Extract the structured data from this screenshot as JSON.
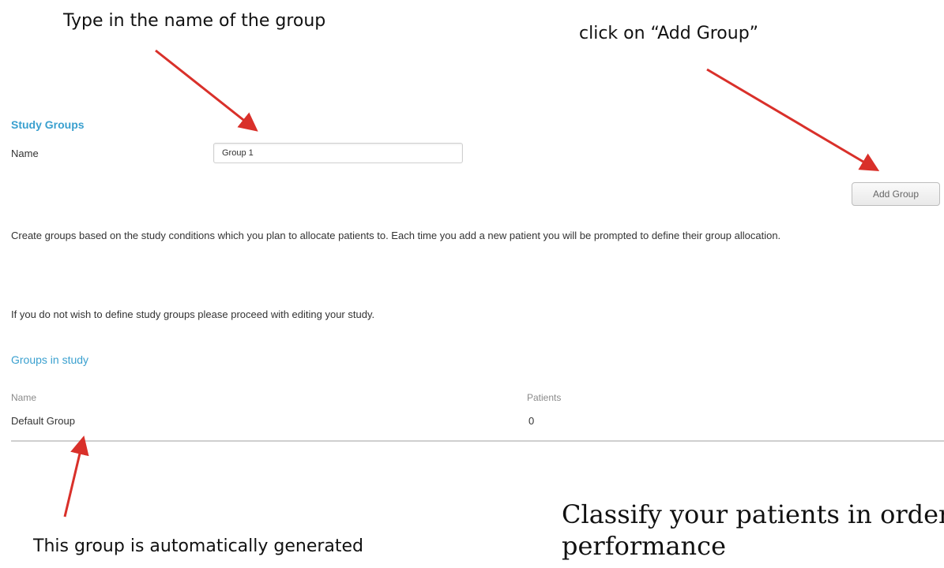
{
  "annotations": {
    "top_left": "Type in the name of the group",
    "top_right": "click on “Add Group”",
    "bottom_left": "This group is automatically generated",
    "bottom_right": "Classify your patients in order performance"
  },
  "study_groups": {
    "heading": "Study Groups",
    "name_label": "Name",
    "name_value": "Group 1",
    "add_button": "Add Group",
    "description": "Create groups based on the study conditions which you plan to allocate patients to. Each time you add a new patient you will be prompted to define their group allocation.",
    "note": "If you do not wish to define study groups please proceed with editing your study."
  },
  "groups_table": {
    "heading": "Groups in study",
    "columns": [
      "Name",
      "Patients"
    ],
    "rows": [
      {
        "name": "Default Group",
        "patients": "0"
      }
    ]
  },
  "colors": {
    "section_heading": "#3aa0cf",
    "arrow": "#d9302a"
  }
}
